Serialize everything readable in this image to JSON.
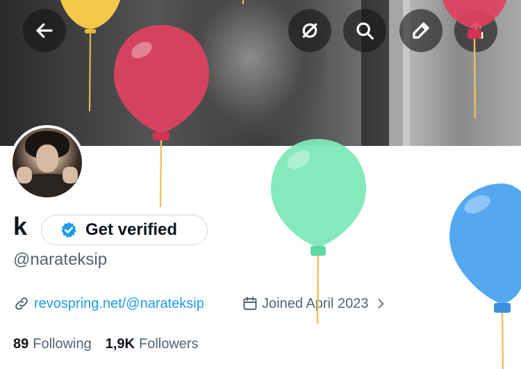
{
  "banner": {
    "description_icon": "header-photo"
  },
  "top_bar": {
    "back_icon": "back-arrow-icon",
    "buttons": [
      "sync-slash-icon",
      "search-icon",
      "edit-pencil-icon",
      "share-icon"
    ]
  },
  "profile": {
    "name": "k",
    "verify_label": "Get verified",
    "handle": "@narateksip",
    "website": "revospring.net/@narateksip",
    "joined": "Joined April 2023"
  },
  "stats": {
    "following_count": "89",
    "following_label": "Following",
    "followers_count": "1,9K",
    "followers_label": "Followers"
  },
  "colors": {
    "accent": "#1d9bf0",
    "secondary_text": "#536471",
    "balloon_red": "#e0415f",
    "balloon_green": "#7de8b7",
    "balloon_blue": "#4aa3f0",
    "balloon_yellow": "#f3c94b"
  }
}
